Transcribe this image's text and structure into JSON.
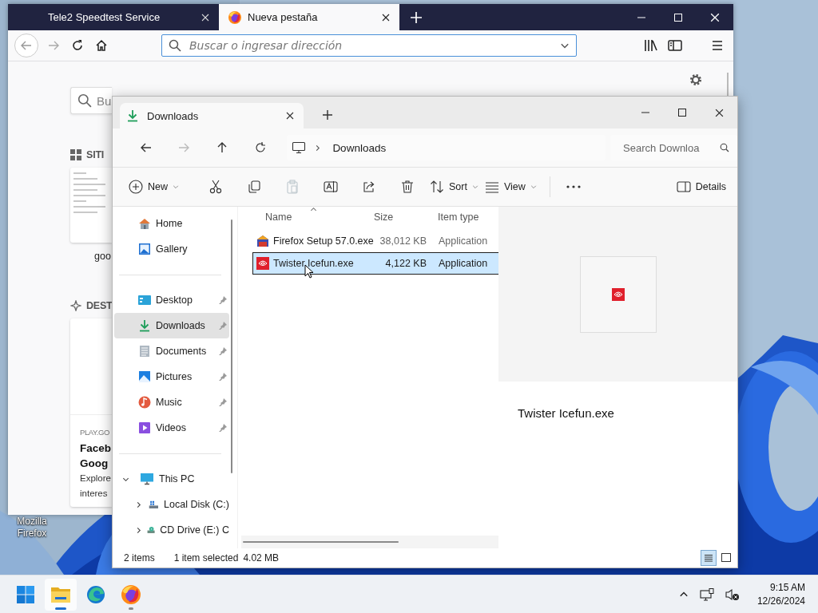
{
  "desktop": {
    "icons": [
      {
        "label": "Mozilla Firefox"
      }
    ]
  },
  "browser": {
    "tabs": [
      {
        "title": "Tele2 Speedtest Service",
        "kind": "plain",
        "selected": false
      },
      {
        "title": "Nueva pestaña",
        "kind": "favicon",
        "selected": true
      }
    ],
    "address_bar": {
      "placeholder": "Buscar o ingresar dirección"
    },
    "new_tab_page": {
      "search": {
        "placeholder": "Bu"
      },
      "top_sites": {
        "heading": "SITI",
        "sites": [
          {
            "title": "goo"
          }
        ]
      },
      "highlights": {
        "heading": "DEST",
        "cards": [
          {
            "source": "PLAY.GO",
            "title_lines": [
              "Faceb",
              "Goog"
            ],
            "description_lines": [
              "Explore",
              "interes"
            ]
          }
        ]
      }
    }
  },
  "explorer": {
    "tab": {
      "title": "Downloads"
    },
    "breadcrumb": [
      {
        "label": "Downloads"
      }
    ],
    "search": {
      "placeholder": "Search Downloa"
    },
    "toolbar": [
      {
        "kind": "new",
        "label": "New",
        "disabled": false
      },
      {
        "kind": "cut",
        "disabled": false
      },
      {
        "kind": "copy",
        "disabled": false
      },
      {
        "kind": "paste",
        "disabled": true
      },
      {
        "kind": "rename",
        "disabled": false
      },
      {
        "kind": "share",
        "disabled": false
      },
      {
        "kind": "delete",
        "disabled": false
      },
      {
        "kind": "sort",
        "label": "Sort",
        "disabled": false
      },
      {
        "kind": "view",
        "label": "View",
        "disabled": false
      },
      {
        "kind": "more",
        "disabled": false
      },
      {
        "kind": "details",
        "label": "Details",
        "disabled": false
      }
    ],
    "nav": {
      "groups": [
        {
          "items": [
            {
              "kind": "home",
              "label": "Home",
              "selected": false,
              "pinned": false
            },
            {
              "kind": "gallery",
              "label": "Gallery",
              "selected": false,
              "pinned": false
            }
          ]
        },
        {
          "items": [
            {
              "kind": "desktop",
              "label": "Desktop",
              "selected": false,
              "pinned": true
            },
            {
              "kind": "downloads",
              "label": "Downloads",
              "selected": true,
              "pinned": true
            },
            {
              "kind": "documents",
              "label": "Documents",
              "selected": false,
              "pinned": true
            },
            {
              "kind": "pictures",
              "label": "Pictures",
              "selected": false,
              "pinned": true
            },
            {
              "kind": "music",
              "label": "Music",
              "selected": false,
              "pinned": true
            },
            {
              "kind": "videos",
              "label": "Videos",
              "selected": false,
              "pinned": true
            }
          ]
        },
        {
          "items": [
            {
              "kind": "this-pc",
              "label": "This PC",
              "selected": false,
              "pinned": false,
              "expanded": true,
              "children": [
                {
                  "kind": "local-disk",
                  "label": "Local Disk (C:)",
                  "selected": false,
                  "pinned": false,
                  "expanded": false
                },
                {
                  "kind": "cd-drive",
                  "label": "CD Drive (E:) C",
                  "selected": false,
                  "pinned": false,
                  "expanded": false
                }
              ]
            }
          ]
        }
      ]
    },
    "files": {
      "columns": [
        {
          "label": "Name",
          "sorted": true
        },
        {
          "label": "Size",
          "sorted": false
        },
        {
          "label": "Item type",
          "sorted": false
        }
      ],
      "rows": [
        {
          "kind": "installer",
          "name": "Firefox Setup 57.0.exe",
          "size": "38,012 KB",
          "type": "Application",
          "selected": false
        },
        {
          "kind": "red-app",
          "name": "Twister Icefun.exe",
          "size": "4,122 KB",
          "type": "Application",
          "selected": true
        }
      ]
    },
    "preview": {
      "title": "Twister Icefun.exe"
    },
    "status_bar": {
      "item_count": "2 items",
      "selection": "1 item selected",
      "selection_size": "4.02 MB"
    },
    "view_modes": [
      {
        "kind": "details",
        "selected": true
      },
      {
        "kind": "large-preview",
        "selected": false
      }
    ]
  },
  "taskbar": {
    "apps": [
      {
        "kind": "start",
        "running": false,
        "active": false
      },
      {
        "kind": "explorer",
        "running": true,
        "active": true
      },
      {
        "kind": "edge",
        "running": false,
        "active": false
      },
      {
        "kind": "firefox",
        "running": true,
        "active": false
      }
    ],
    "clock": {
      "time": "9:15 AM",
      "date": "12/26/2024"
    }
  }
}
